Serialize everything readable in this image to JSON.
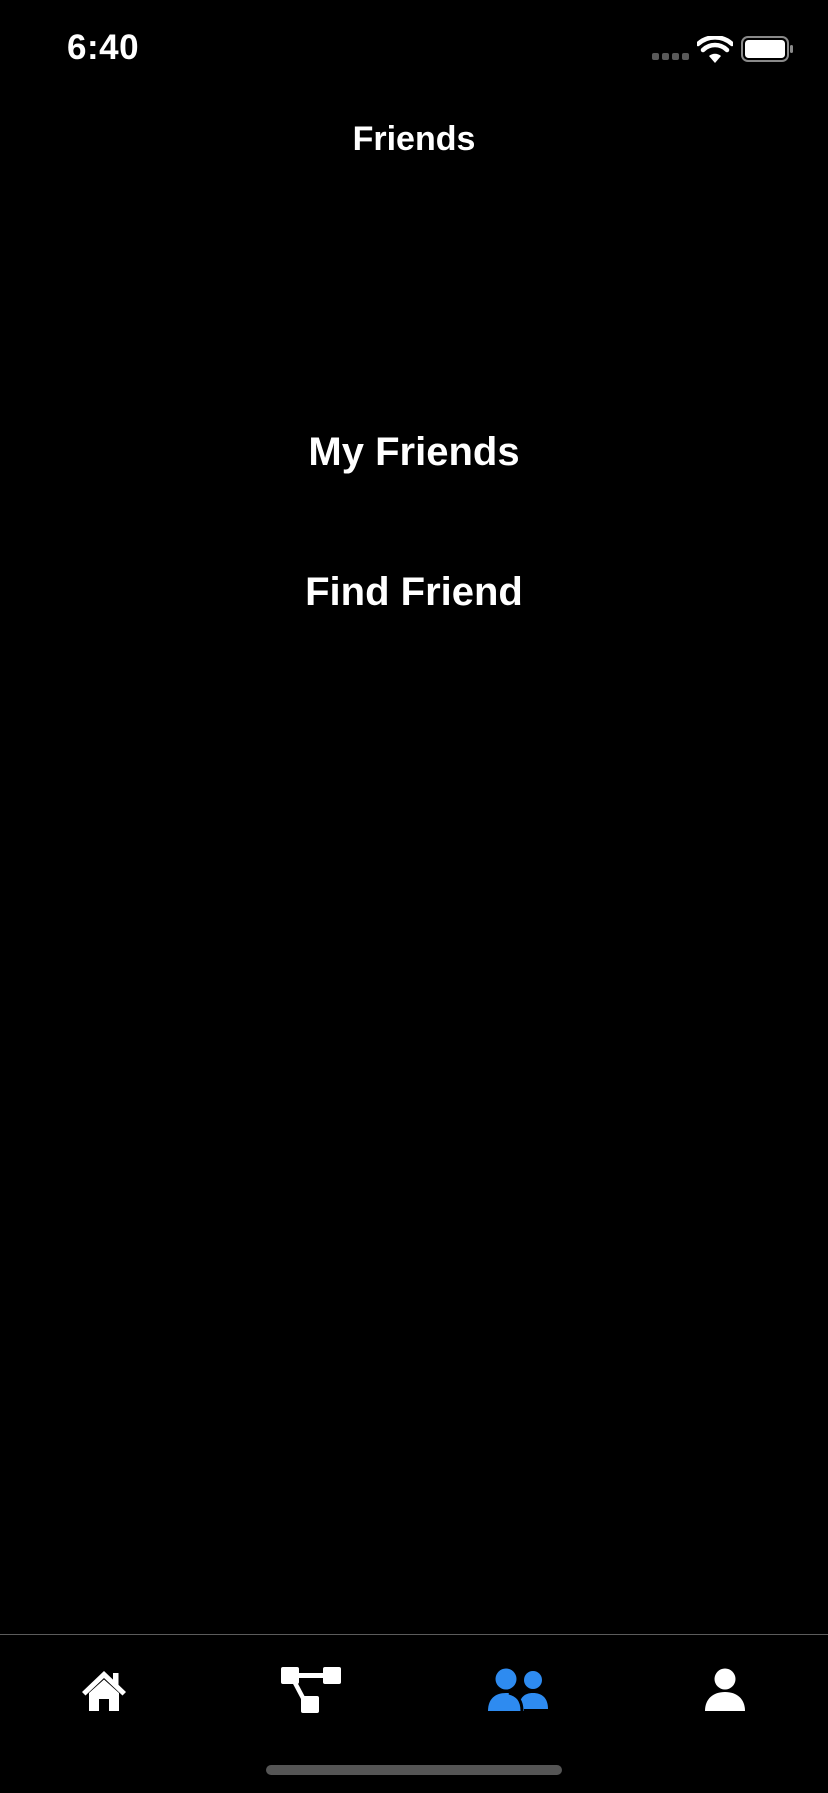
{
  "status_bar": {
    "time": "6:40"
  },
  "nav": {
    "title": "Friends"
  },
  "menu": {
    "my_friends_label": "My Friends",
    "find_friend_label": "Find Friend"
  },
  "tab_bar": {
    "tabs": [
      {
        "icon": "home-icon",
        "selected": false
      },
      {
        "icon": "flow-chart-icon",
        "selected": false
      },
      {
        "icon": "friends-icon",
        "selected": true
      },
      {
        "icon": "profile-icon",
        "selected": false
      }
    ],
    "active_color": "#2E8BF0",
    "inactive_color": "#FFFFFF"
  }
}
